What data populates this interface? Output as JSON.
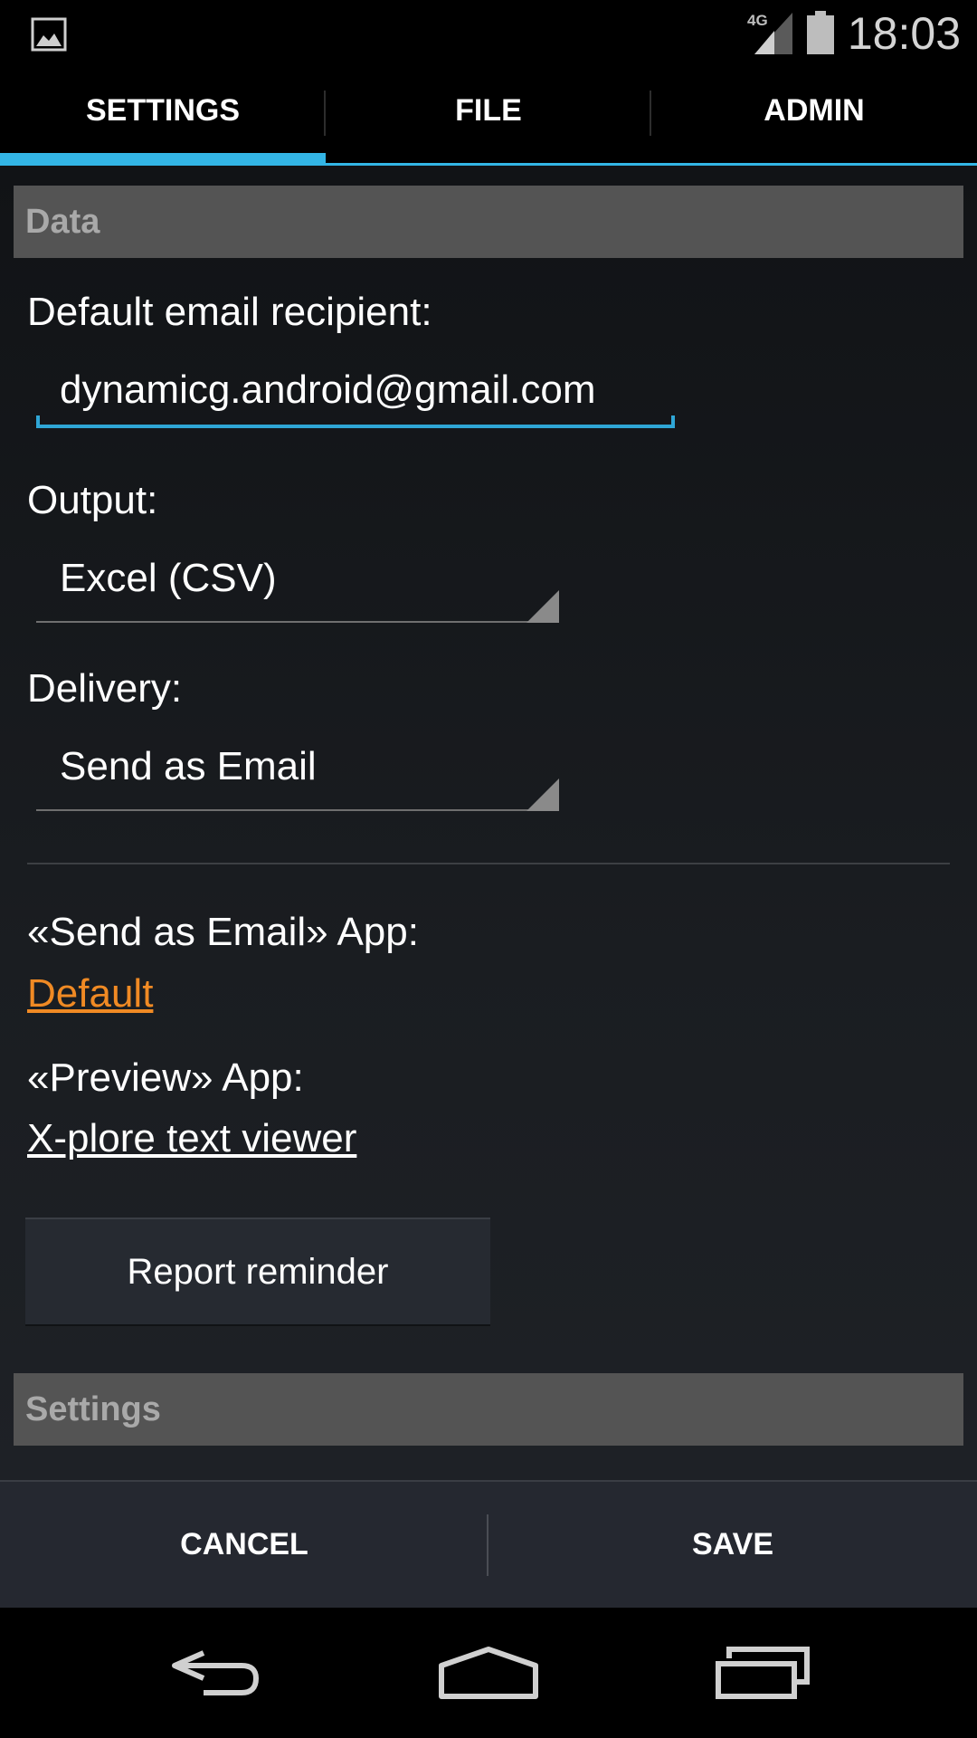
{
  "status_bar": {
    "network": "4G",
    "time": "18:03"
  },
  "tabs": [
    {
      "label": "SETTINGS",
      "active": true
    },
    {
      "label": "FILE",
      "active": false
    },
    {
      "label": "ADMIN",
      "active": false
    }
  ],
  "data_section": {
    "header": "Data",
    "email_label": "Default email recipient:",
    "email_value": "dynamicg.android@gmail.com",
    "output_label": "Output:",
    "output_value": "Excel (CSV)",
    "delivery_label": "Delivery:",
    "delivery_value": "Send as Email",
    "send_app_label": "«Send as Email» App:",
    "send_app_value": "Default",
    "preview_app_label": "«Preview» App:",
    "preview_app_value": "X-plore text viewer",
    "report_reminder_label": "Report reminder"
  },
  "settings_section": {
    "header": "Settings"
  },
  "actions": {
    "cancel": "CANCEL",
    "save": "SAVE"
  },
  "colors": {
    "accent": "#33b5e5",
    "link_orange": "#f08a24",
    "section_header_bg": "#545454"
  },
  "icons": {
    "status": [
      "gallery-icon",
      "signal-icon",
      "battery-icon"
    ],
    "nav": [
      "back-icon",
      "home-icon",
      "recents-icon"
    ]
  }
}
